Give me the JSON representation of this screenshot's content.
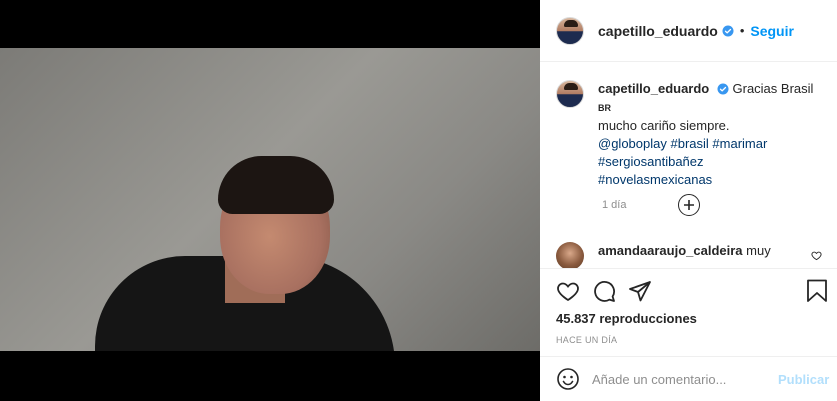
{
  "header": {
    "username": "capetillo_eduardo",
    "separator": "•",
    "follow_label": "Seguir"
  },
  "caption": {
    "username": "capetillo_eduardo",
    "text_1": "Gracias Brasil",
    "flag": "BR",
    "text_2": "mucho cariño siempre.",
    "mentions": [
      "@globoplay",
      "#brasil",
      "#marimar",
      "#sergiosantibañez",
      "#novelasmexicanas"
    ],
    "age": "1 día"
  },
  "comment": {
    "username": "amandaaraujo_caldeira",
    "text": "muy"
  },
  "post": {
    "views": "45.837 reproducciones",
    "date": "HACE UN DÍA"
  },
  "compose": {
    "placeholder": "Añade un comentario...",
    "publish_label": "Publicar"
  },
  "icons": {
    "verified": "verified-badge-icon",
    "load_more": "plus-circle-icon",
    "like": "heart-icon",
    "comment": "comment-bubble-icon",
    "share": "paper-plane-icon",
    "save": "bookmark-icon",
    "emoji": "smiley-icon",
    "mute": "volume-icon"
  },
  "colors": {
    "link_blue": "#0095f6",
    "tag_blue": "#00376b",
    "publish_disabled": "#b2dffc",
    "muted_text": "#8e8e8e"
  }
}
